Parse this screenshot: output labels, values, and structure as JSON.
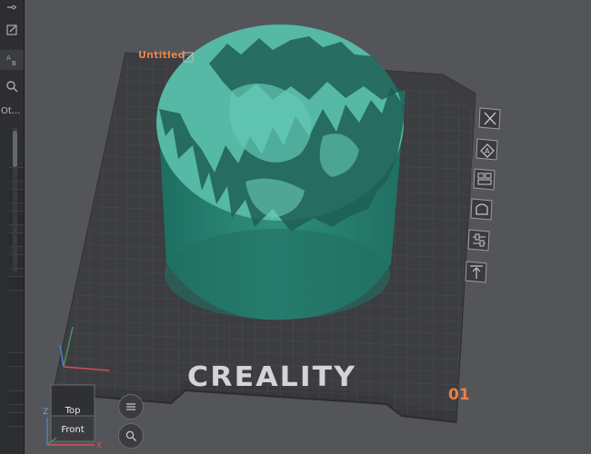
{
  "plate": {
    "title": "Untitled",
    "number": "01",
    "brand": "CREALITY"
  },
  "left_toolbar": {
    "partial_label": "Ot..."
  },
  "view_cube": {
    "top_label": "Top",
    "front_label": "Front",
    "z_label": "Z",
    "x_label": "X"
  },
  "colors": {
    "accent": "#ec8146",
    "model": "#2a8a78",
    "model_light": "#5ec2b0",
    "plate": "#3a3b3e",
    "background": "#545559"
  },
  "side_toolbar_icons": [
    "close-icon",
    "auto-orient-icon",
    "arrange-icon",
    "support-icon",
    "layer-settings-icon",
    "lay-flat-icon"
  ]
}
